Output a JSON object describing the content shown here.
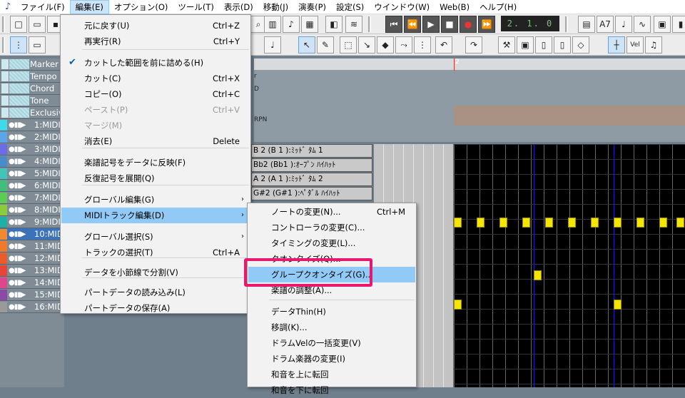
{
  "menubar": {
    "items": [
      "ファイル(F)",
      "編集(E)",
      "オプション(O)",
      "ツール(T)",
      "表示(D)",
      "移動(J)",
      "演奏(P)",
      "設定(S)",
      "ウインドウ(W)",
      "Web(B)",
      "ヘルプ(H)"
    ]
  },
  "toolbar": {
    "position": "2. 1. 0"
  },
  "ruler": {
    "marker": "2"
  },
  "tracks": {
    "special": [
      "Marker",
      "Tempo",
      "Chord",
      "Tone",
      "Exclusive"
    ],
    "midi": [
      {
        "label": "1:MIDI",
        "color": "#3fd9e9"
      },
      {
        "label": "2:MIDI",
        "color": "#5aa6e8"
      },
      {
        "label": "3:MIDI",
        "color": "#6c6ce6"
      },
      {
        "label": "4:MIDI",
        "color": "#4a8cc9"
      },
      {
        "label": "5:MIDI",
        "color": "#43c4b8"
      },
      {
        "label": "6:MIDI",
        "color": "#3fbf7a"
      },
      {
        "label": "7:MIDI",
        "color": "#5ccc55"
      },
      {
        "label": "8:MIDI",
        "color": "#8ccc3a"
      },
      {
        "label": "9:MIDI",
        "color": "#1fb0a5"
      },
      {
        "label": "10:MID",
        "color": "#f08a2c"
      },
      {
        "label": "11:MID",
        "color": "#f07a2a"
      },
      {
        "label": "12:MID",
        "color": "#ee5b2a"
      },
      {
        "label": "13:MID",
        "color": "#e8453a"
      },
      {
        "label": "14:MID",
        "color": "#e0458d"
      },
      {
        "label": "15:MID",
        "color": "#8c4aa8"
      },
      {
        "label": "16:MID",
        "color": "#9a9a9a"
      }
    ]
  },
  "control_labels": [
    "r",
    "D",
    "RPN"
  ],
  "drum_notes": [
    "B 2 (B 1 ):ﾐｯﾄﾞ ﾀﾑ 1",
    "Bb2 (Bb1 ):ｵｰﾌﾟﾝ ﾊｲﾊｯﾄ",
    "A 2 (A 1 ):ﾐｯﾄﾞ ﾀﾑ 2",
    "G#2 (G#1 ):ﾍﾟﾀﾞﾙ ﾊｲﾊｯﾄ"
  ],
  "edit_menu": {
    "items": [
      {
        "label": "元に戻す(U)",
        "shortcut": "Ctrl+Z"
      },
      {
        "label": "再実行(R)",
        "shortcut": "Ctrl+Y"
      },
      {
        "label": "カットした範囲を前に詰める(H)",
        "checked": true
      },
      {
        "label": "カット(C)",
        "shortcut": "Ctrl+X"
      },
      {
        "label": "コピー(O)",
        "shortcut": "Ctrl+C"
      },
      {
        "label": "ペースト(P)",
        "shortcut": "Ctrl+V",
        "disabled": true
      },
      {
        "label": "マージ(M)",
        "disabled": true
      },
      {
        "label": "消去(E)",
        "shortcut": "Delete"
      },
      {
        "label": "楽譜記号をデータに反映(F)"
      },
      {
        "label": "反復記号を展開(Q)"
      },
      {
        "label": "グローバル編集(G)",
        "submenu": true
      },
      {
        "label": "MIDIトラック編集(D)",
        "submenu": true,
        "highlighted": true
      },
      {
        "label": "グローバル選択(S)",
        "submenu": true
      },
      {
        "label": "トラックの選択(T)",
        "shortcut": "Ctrl+A"
      },
      {
        "label": "データを小節線で分割(V)"
      },
      {
        "label": "パートデータの読み込み(L)"
      },
      {
        "label": "パートデータの保存(A)"
      }
    ]
  },
  "midi_track_submenu": {
    "items": [
      {
        "label": "ノートの変更(N)...",
        "shortcut": "Ctrl+M"
      },
      {
        "label": "コントローラの変更(C)..."
      },
      {
        "label": "タイミングの変更(L)..."
      },
      {
        "label": "クオンタイズ(Q)..."
      },
      {
        "label": "グループクオンタイズ(G)...",
        "highlighted": true
      },
      {
        "label": "楽譜の調整(A)..."
      },
      {
        "label": "データThin(H)"
      },
      {
        "label": "移調(K)..."
      },
      {
        "label": "ドラムVelの一括変更(V)"
      },
      {
        "label": "ドラム楽器の変更(I)"
      },
      {
        "label": "和音を上に転回"
      },
      {
        "label": "和音を下に転回"
      }
    ]
  },
  "colors": {
    "highlight": "#91c9f7",
    "callout": "#e8196c",
    "note": "#f5e600"
  }
}
